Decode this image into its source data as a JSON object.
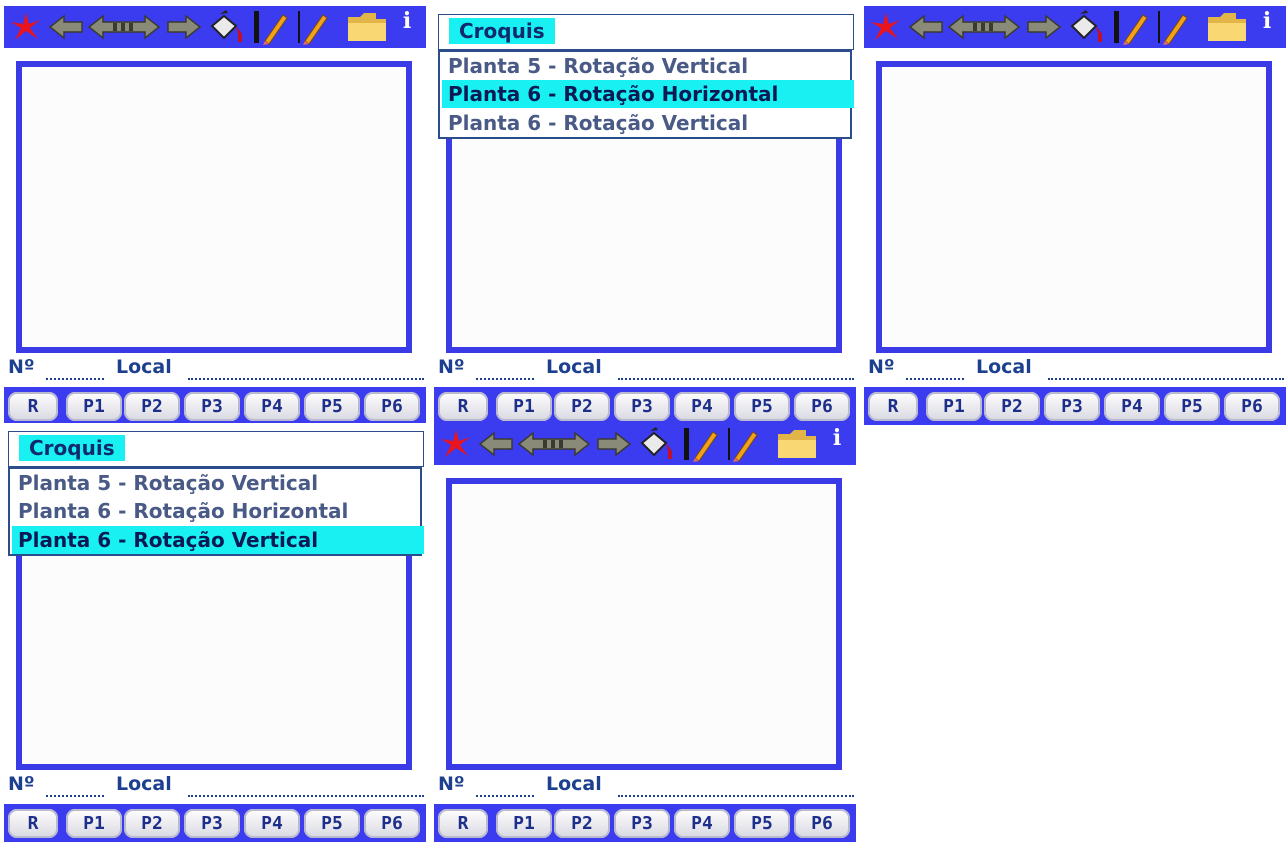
{
  "form": {
    "number_label": "Nº",
    "local_label": "Local"
  },
  "plant_buttons": [
    "R",
    "P1",
    "P2",
    "P3",
    "P4",
    "P5",
    "P6"
  ],
  "toolbar": {
    "icons": [
      "sketch-star-icon",
      "left-arrow-icon",
      "left-right-arrow-icon",
      "right-arrow-icon",
      "paint-bucket-icon",
      "pencil-with-bar-icon",
      "pencil-icon",
      "folder-icon",
      "info-icon"
    ],
    "info_label": "i"
  },
  "dropdown": {
    "title": "Croquis",
    "items": [
      "Planta 5 - Rotação Vertical",
      "Planta 6 - Rotação Horizontal",
      "Planta 6 - Rotação Vertical"
    ]
  },
  "panels": [
    {
      "id": "top-left",
      "header": "toolbar"
    },
    {
      "id": "top-middle",
      "header": "dropdown",
      "selected": "Planta 6 - Rotação Horizontal"
    },
    {
      "id": "top-right",
      "header": "toolbar"
    },
    {
      "id": "bottom-left",
      "header": "dropdown",
      "selected": "Planta 6 - Rotação Vertical"
    },
    {
      "id": "bottom-middle",
      "header": "toolbar"
    }
  ],
  "colors": {
    "toolbar_blue": "#3b3bf0",
    "canvas_border": "#3a3ae6",
    "selection_cyan": "#18f0f2",
    "text_navy": "#1c3f8f"
  }
}
